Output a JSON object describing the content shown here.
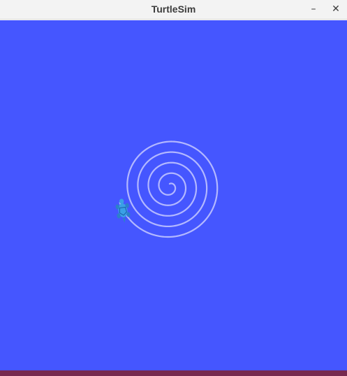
{
  "window": {
    "title": "TurtleSim",
    "minimize_icon": "minimize-icon",
    "close_icon": "close-icon",
    "minimize_glyph": "–",
    "close_glyph": "✕"
  },
  "simulation": {
    "background_color": "#4556ff",
    "pen_color": "#b3b8ff",
    "turtle_color": "#3aa0e6",
    "path_shape": "spiral",
    "turtle_icon": "turtle-icon"
  }
}
